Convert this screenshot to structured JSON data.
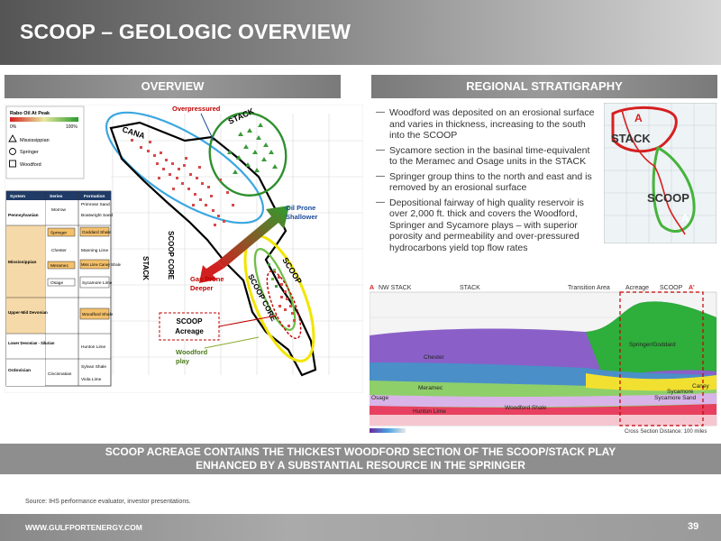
{
  "title": "SCOOP – GEOLOGIC OVERVIEW",
  "sections": {
    "overview": "OVERVIEW",
    "stratigraphy": "REGIONAL STRATIGRAPHY"
  },
  "map": {
    "legend_title": "Rabo Oil At Peak",
    "legend_min": "0%",
    "legend_max": "100%",
    "legend_items": [
      "Mississippian",
      "Springer",
      "Woodford"
    ],
    "labels": {
      "overpressured": "Overpressured",
      "cana": "CANA",
      "stack": "STACK",
      "scoop": "SCOOP",
      "scoop_core": "SCOOP CORE",
      "oil_prone_1": "Oil Prone",
      "oil_prone_2": "Shallower",
      "gas_prone_1": "Gas Prone",
      "gas_prone_2": "Deeper",
      "acreage_1": "SCOOP",
      "acreage_2": "Acreage",
      "woodford_play_1": "Woodford",
      "woodford_play_2": "play"
    }
  },
  "strat_table": {
    "headers": [
      "System",
      "Series",
      "Formation"
    ],
    "systems": [
      "Pennsylvanian",
      "Mississippian",
      "Upper-Mid Devonian",
      "Lower Devonian - Silurian",
      "Ordovician"
    ],
    "series": [
      "Morrow",
      "Springer",
      "Chester",
      "Meramec",
      "Osage",
      "Cincinnatian"
    ],
    "formations": [
      "Primrose Sand",
      "Boatwright Sand",
      "Goddard Shale",
      "Manning Lime",
      "Miss Lime Caney Shale",
      "Sycamore Lime",
      "Woodford Shale",
      "Hunton Lime",
      "Sylvan Shale",
      "Viola Lime"
    ]
  },
  "bullets": [
    "Woodford was deposited on an erosional surface and varies in thickness, increasing to the south into the SCOOP",
    "Sycamore section in the basinal time-equivalent to the Meramec and Osage units in the STACK",
    "Springer group thins to the north and east and is removed by an erosional surface",
    "Depositional fairway of high quality reservoir is over 2,000 ft. thick and covers the Woodford, Springer and Sycamore plays – with superior porosity and permeability and over-pressured hydrocarbons yield top flow rates"
  ],
  "inset_map": {
    "a": "A",
    "a_prime": "A'",
    "stack": "STACK",
    "scoop": "SCOOP"
  },
  "cross_section": {
    "a": "A",
    "a_prime": "A'",
    "regions": [
      "NW STACK",
      "STACK",
      "Transition Area",
      "Acreage",
      "SCOOP"
    ],
    "layers": [
      "Chester",
      "Meramec",
      "Osage",
      "Hunton Lime",
      "Woodford Shale",
      "Springer/Goddard",
      "Sycamore",
      "Caney",
      "Sycamore Sand"
    ],
    "distance_label": "Cross Section Distance: 100 miles"
  },
  "banner": {
    "line1": "SCOOP ACREAGE CONTAINS THE THICKEST WOODFORD SECTION OF THE SCOOP/STACK PLAY",
    "line2": "ENHANCED BY A SUBSTANTIAL RESOURCE IN THE SPRINGER"
  },
  "source": "Source: IHS performance evaluator, investor presentations.",
  "footer": {
    "url": "WWW.GULFPORTENERGY.COM",
    "page": "39"
  },
  "colors": {
    "title_gray": "#6b6b6b",
    "stack_green": "#2f8f2f",
    "scoop_yellow": "#f2e500",
    "cana_blue": "#3ba7e0",
    "arrow_red": "#d02020",
    "arrow_green": "#2e9e2e",
    "acreage_red": "#c00000"
  }
}
